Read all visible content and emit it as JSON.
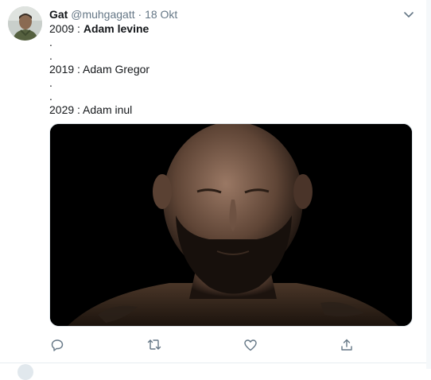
{
  "tweet": {
    "author_name": "Gat",
    "author_handle": "@muhgagatt",
    "separator": "·",
    "date": "18 Okt",
    "lines": [
      {
        "prefix": "2009 : ",
        "emph": "Adam levine"
      },
      {
        "text": "."
      },
      {
        "text": "."
      },
      {
        "text": "2019 : Adam Gregor"
      },
      {
        "text": "."
      },
      {
        "text": "."
      },
      {
        "text": "2029 : Adam inul"
      }
    ],
    "media_alt": "video-still-bearded-man",
    "actions": {
      "reply_icon": "reply-icon",
      "retweet_icon": "retweet-icon",
      "like_icon": "heart-icon",
      "share_icon": "share-icon"
    }
  },
  "colors": {
    "text": "#14171a",
    "secondary": "#657786",
    "icon": "#657786",
    "divider": "#e6ecf0",
    "media_bg": "#000000"
  }
}
